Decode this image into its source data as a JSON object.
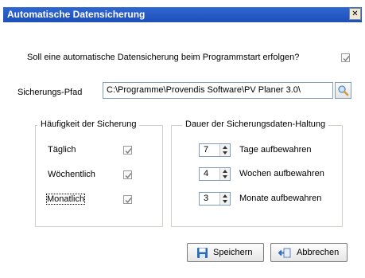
{
  "window": {
    "title": "Automatische Datensicherung",
    "close_glyph": "✕"
  },
  "startup_question": {
    "label": "Soll eine automatische Datensicherung beim Programmstart erfolgen?",
    "checked": true
  },
  "path": {
    "label": "Sicherungs-Pfad",
    "value": "C:\\Programme\\Provendis Software\\PV Planer 3.0\\",
    "browse_icon": "search-icon"
  },
  "frequency": {
    "title": "Häufigkeit der Sicherung",
    "items": [
      {
        "label": "Täglich",
        "checked": true
      },
      {
        "label": "Wöchentlich",
        "checked": true
      },
      {
        "label": "Monatlich",
        "checked": true
      }
    ]
  },
  "retention": {
    "title": "Dauer der Sicherungsdaten-Haltung",
    "items": [
      {
        "value": "7",
        "label": "Tage aufbewahren"
      },
      {
        "value": "4",
        "label": "Wochen aufbewahren"
      },
      {
        "value": "3",
        "label": "Monate aufbewahren"
      }
    ]
  },
  "buttons": {
    "save": {
      "label": "Speichern",
      "icon": "floppy-disk-icon"
    },
    "cancel": {
      "label": "Abbrechen",
      "icon": "cancel-icon"
    }
  },
  "colors": {
    "titlebar": "#2f67d1",
    "check": "#7a7a7a",
    "field_border": "#7f9db9"
  }
}
